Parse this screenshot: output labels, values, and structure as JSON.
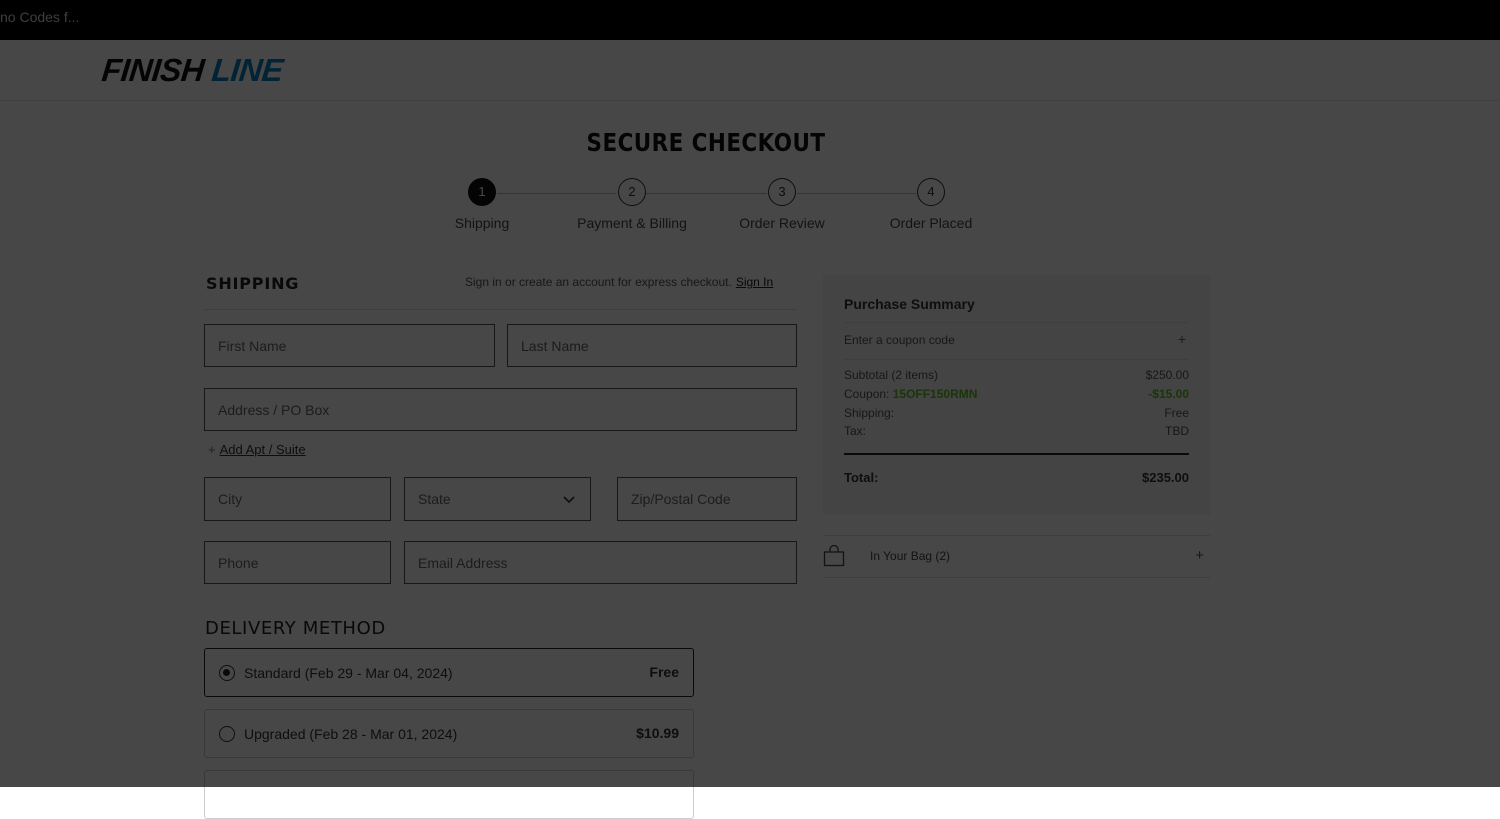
{
  "browser": {
    "tab_title": "no Codes f..."
  },
  "header": {
    "logo_word1": "FINISH",
    "logo_word2": "LINE"
  },
  "checkout": {
    "title": "SECURE CHECKOUT",
    "steps": [
      {
        "number": "1",
        "label": "Shipping"
      },
      {
        "number": "2",
        "label": "Payment & Billing"
      },
      {
        "number": "3",
        "label": "Order Review"
      },
      {
        "number": "4",
        "label": "Order Placed"
      }
    ]
  },
  "shipping": {
    "heading": "SHIPPING",
    "signin_prompt": "Sign in or create an account for express checkout.",
    "signin_link": "Sign In",
    "fields": {
      "first_name": "First Name",
      "last_name": "Last Name",
      "address": "Address / PO Box",
      "city": "City",
      "state": "State",
      "zip": "Zip/Postal Code",
      "phone": "Phone",
      "email": "Email Address"
    },
    "add_apt": "Add Apt / Suite"
  },
  "delivery": {
    "heading": "DELIVERY METHOD",
    "options": [
      {
        "label": "Standard (Feb 29 - Mar 04, 2024)",
        "price": "Free"
      },
      {
        "label": "Upgraded (Feb 28 - Mar 01, 2024)",
        "price": "$10.99"
      }
    ]
  },
  "summary": {
    "title": "Purchase Summary",
    "coupon_placeholder": "Enter a coupon code",
    "coupon_plus": "+",
    "subtotal_label": "Subtotal (2 items)",
    "subtotal_value": "$250.00",
    "coupon_label": "Coupon:",
    "coupon_code": "15OFF150RMN",
    "coupon_value": "-$15.00",
    "shipping_label": "Shipping:",
    "shipping_value": "Free",
    "tax_label": "Tax:",
    "tax_value": "TBD",
    "total_label": "Total:",
    "total_value": "$235.00"
  },
  "bag": {
    "label": "In Your Bag (2)",
    "plus": "+"
  }
}
